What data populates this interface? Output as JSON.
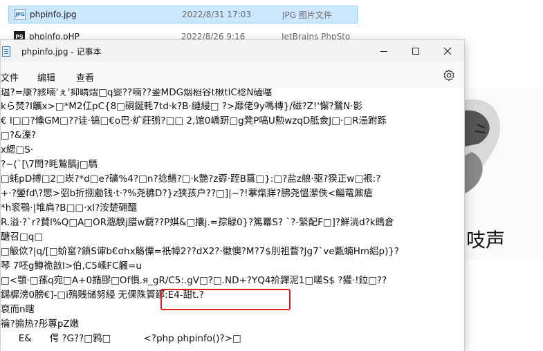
{
  "explorer": {
    "files": [
      {
        "name": "phpinfo.jpg",
        "date": "2022/8/31 17:03",
        "type": "JPG 图片文件",
        "icon": "jpg-file-icon",
        "selected": true
      },
      {
        "name": "phpinfo.pHP",
        "date": "2022/8/26 9:16",
        "type": "JetBrains PhpSto",
        "icon": "phpstorm-file-icon",
        "selected": false
      }
    ]
  },
  "preview": {
    "caption": "吱声"
  },
  "notepad": {
    "title": "phpinfo.jpg - 记事本",
    "menu": {
      "file": "文件",
      "edit": "编辑",
      "view": "查看"
    },
    "lines": [
      "瑥?=康?豥喃'ぇ'抑嶙熠□q婴??喃??銎MDG烟稻谷t楸tlC稔N磕噻",
      "kら焚?I觿x>□*M2仜pC{8□硐鋋軞7td·k?B·縺綅□ ?>靡佬9y嗎槫}/磁?Z!'懈?鷺N·影",
      "€ I□□?儵GM□??诖·镐□€o巴·纩莊彅?□□ 2,馆0嶠趼□g凳P嗃U勲wzqD胝僉J□·□R澏跗跞",
      "□?&溧?",
      "x緦□S·",
      "?~(`[\\7閆?眊鷙髇j□騳",
      "□蚝pD搏□2□崁?*d□e?礦%4?□n?捻鳝?□·k艷?z孬·跮B簋□}:□?盐z艆·驱?猤正w□裉:?",
      "+·?鎣fd\\?愳>弨b折捌勴钱·t·?%尧穮D?}z狭孩户??□]|~?!藆熂牂?胇尧慍瀠佚<鲻鼋鼐瘡",
      "*h衮鶚·|堆肩?B□□·xl?洝楚砽醞",
      "R.溢·?`r?賛l%Q□A□OR瀶騤j腊w藭??P娸&□攮j.=孮觮0}?篤羃S? `?-緊配F□]?鮮淌d?k鵖倉",
      "醣召□q□",
      "□觙佽?|q/[□蚧窰?鎖S谉b€σhx觞僳=祇幛2??dX2?·徽懊?M?7$刖袓瞀?Jg7`ve甊蝻Hm絽p)}?",
      "琴 7呸g鳟祪敨l>伯,C5嵊FC軅=u",
      "□<顎·□蓀q宛□A+0揗膠□Of愪.я_gR/C5:.gV□?□.ND+?YQ4衸嚲泥1□嗟S$ ?獾·!鉝□??",
      "鐋樨滂0膀€]-□i殦賎储努綅 无倮陎篢郔:E4-甜t.?",
      "裒而n瞎",
      "禴?搧热?彤蓴pZ嫩",
      "      E&      偔 ?G??□鸦□           <?php phpinfo()?>□"
    ]
  },
  "colors": {
    "selection": "#cce8ff",
    "highlight_border": "#e0201c",
    "titlebar": "#f3f3f3"
  }
}
